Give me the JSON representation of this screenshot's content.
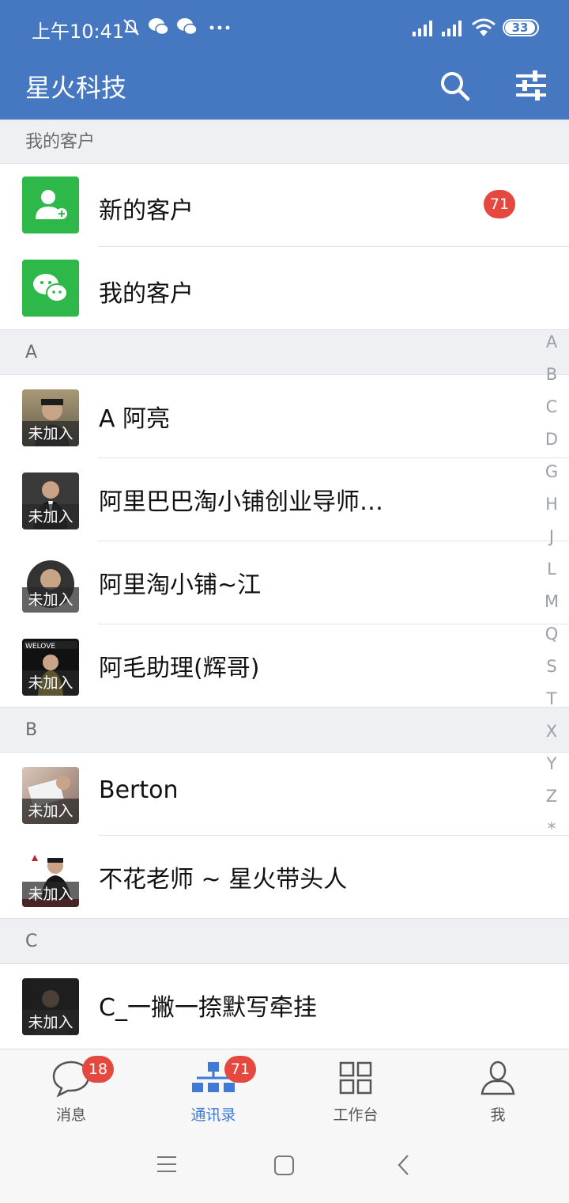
{
  "status_bar": {
    "time": "上午10:41",
    "battery": "33",
    "icons": [
      "bell-off-icon",
      "wechat-icon",
      "wechat-icon",
      "more-dots-icon",
      "signal-icon",
      "signal-icon",
      "wifi-icon",
      "battery-icon"
    ]
  },
  "header": {
    "title": "星火科技",
    "icons": [
      "search-icon",
      "filter-sliders-icon"
    ]
  },
  "sections": {
    "my_customers": "我的客户",
    "A": "A",
    "B": "B",
    "C": "C"
  },
  "top_items": [
    {
      "label": "新的客户",
      "badge": "71",
      "icon": "add-contact-icon"
    },
    {
      "label": "我的客户",
      "icon": "wechat-icon"
    }
  ],
  "contacts": [
    {
      "name": "A 阿亮",
      "tag": "未加入"
    },
    {
      "name": "阿里巴巴淘小铺创业导师…",
      "tag": "未加入"
    },
    {
      "name": "阿里淘小铺~江",
      "tag": "未加入"
    },
    {
      "name": "阿毛助理(辉哥)",
      "tag": "未加入"
    },
    {
      "name": "Berton",
      "tag": "未加入"
    },
    {
      "name": "不花老师 ~ 星火带头人",
      "tag": "未加入"
    },
    {
      "name": "C_一撇一捺默写牵挂",
      "tag": "未加入"
    }
  ],
  "index_letters": [
    "A",
    "B",
    "C",
    "D",
    "G",
    "H",
    "J",
    "L",
    "M",
    "Q",
    "S",
    "T",
    "X",
    "Y",
    "Z",
    "*"
  ],
  "tabbar": {
    "tabs": [
      {
        "label": "消息",
        "badge": "18",
        "icon": "chat-bubble-icon"
      },
      {
        "label": "通讯录",
        "badge": "71",
        "icon": "org-chart-icon",
        "active": true
      },
      {
        "label": "工作台",
        "icon": "grid-icon"
      },
      {
        "label": "我",
        "icon": "person-icon"
      }
    ]
  },
  "colors": {
    "header": "#4578c0",
    "green": "#2eb84a",
    "badge": "#e5483f",
    "active_tab": "#3f7bd6"
  }
}
